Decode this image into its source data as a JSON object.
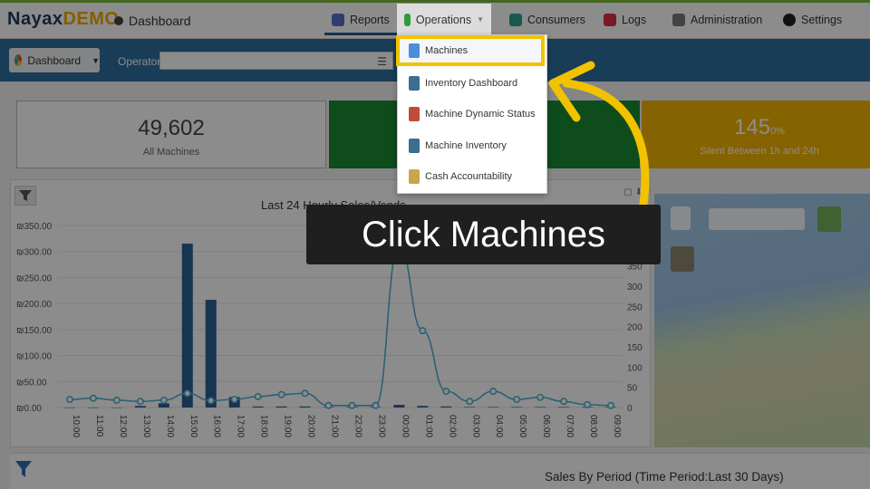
{
  "header": {
    "logo_part1": "Nayax",
    "logo_part2": "DEMO",
    "page_title": "Dashboard"
  },
  "nav": {
    "reports": "Reports",
    "operations": "Operations",
    "consumers": "Consumers",
    "logs": "Logs",
    "administration": "Administration",
    "settings": "Settings"
  },
  "filterbar": {
    "dashboard_button": "Dashboard",
    "operator_label": "Operator",
    "operator_value": ""
  },
  "stats": {
    "all_machines_value": "49,602",
    "all_machines_label": "All Machines",
    "silent_value": "145",
    "silent_percent": "0%",
    "silent_label": "Silent Between 1h and 24h"
  },
  "operations_menu": {
    "items": [
      "Machines",
      "Inventory Dashboard",
      "Machine Dynamic Status",
      "Machine Inventory",
      "Cash Accountability"
    ],
    "highlighted": "Machines"
  },
  "callout": {
    "text": "Click Machines"
  },
  "colors": {
    "highlight": "#f2c200",
    "nav_blue": "#2f6e9e",
    "green_box": "#1a8a34",
    "yellow_box": "#f0b400",
    "bar_color": "#2b5f94",
    "line_color": "#4fb1d4"
  },
  "chart_data": {
    "type": "bar",
    "title": "Last 24 Hourly Sales/Vends",
    "categories": [
      "10:00",
      "11:00",
      "12:00",
      "13:00",
      "14:00",
      "15:00",
      "16:00",
      "17:00",
      "18:00",
      "19:00",
      "20:00",
      "21:00",
      "22:00",
      "23:00",
      "00:00",
      "01:00",
      "02:00",
      "03:00",
      "04:00",
      "05:00",
      "06:00",
      "07:00",
      "08:00",
      "09:00"
    ],
    "series": [
      {
        "axis": "left",
        "type": "bar",
        "values": [
          0,
          0,
          0,
          3,
          8,
          315,
          207,
          20,
          2,
          2,
          2,
          1,
          1,
          1,
          5,
          3,
          2,
          1,
          1,
          1,
          1,
          1,
          1,
          1
        ]
      },
      {
        "axis": "right",
        "type": "line",
        "values": [
          20,
          23,
          18,
          15,
          18,
          35,
          17,
          20,
          27,
          32,
          35,
          5,
          5,
          5,
          400,
          190,
          40,
          15,
          40,
          20,
          25,
          15,
          7,
          5
        ]
      }
    ],
    "y_left_ticks": [
      "₪0.00",
      "₪50.00",
      "₪100.00",
      "₪150.00",
      "₪200.00",
      "₪250.00",
      "₪300.00",
      "₪350.00"
    ],
    "y_left_lim": [
      0,
      350
    ],
    "y_right_ticks": [
      "0",
      "50",
      "100",
      "150",
      "200",
      "250",
      "300",
      "350",
      "400",
      "450"
    ],
    "y_right_lim": [
      0,
      450
    ]
  },
  "bottom": {
    "title": "Sales By Period (Time Period:Last 30 Days)"
  }
}
